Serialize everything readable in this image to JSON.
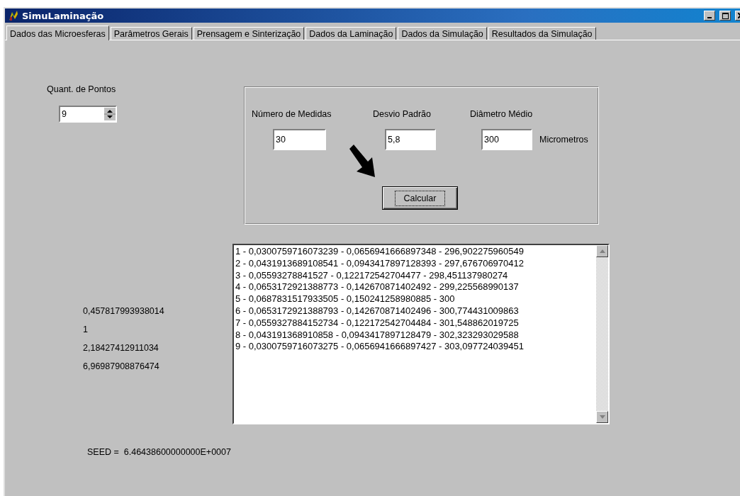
{
  "window": {
    "title": "SimuLaminação"
  },
  "tabs": [
    {
      "label": "Dados das Microesferas",
      "selected": true
    },
    {
      "label": "Parâmetros Gerais",
      "selected": false
    },
    {
      "label": "Prensagem e Sinterização",
      "selected": false
    },
    {
      "label": "Dados da Laminação",
      "selected": false
    },
    {
      "label": "Dados da Simulação",
      "selected": false
    },
    {
      "label": "Resultados da Simulação",
      "selected": false
    }
  ],
  "points": {
    "label": "Quant. de Pontos",
    "value": "9"
  },
  "group": {
    "fields": [
      {
        "label": "Número de Medidas",
        "value": "30"
      },
      {
        "label": "Desvio Padrão",
        "value": "5,8"
      },
      {
        "label": "Diâmetro Médio",
        "value": "300",
        "unit": "Micrometros"
      }
    ],
    "button": "Calcular"
  },
  "results": [
    "1 - 0,0300759716073239 - 0,0656941666897348 - 296,902275960549",
    "2 - 0,0431913689108541 - 0,0943417897128393 - 297,676706970412",
    "3 - 0,05593278841527 - 0,122172542704477 - 298,451137980274",
    "4 - 0,0653172921388773 - 0,142670871402492 - 299,225568990137",
    "5 - 0,0687831517933505 - 0,150241258980885 - 300",
    "6 - 0,0653172921388793 - 0,142670871402496 - 300,774431009863",
    "7 - 0,0559327884152734 - 0,122172542704484 - 301,548862019725",
    "8 - 0,043191368910858 - 0,0943417897128479 - 302,323293029588",
    "9 - 0,0300759716073275 - 0,0656941666897427 - 303,097724039451"
  ],
  "values": [
    "0,457817993938014",
    "1",
    "2,18427412911034",
    "6,96987908876474"
  ],
  "seed": "SEED =  6.46438600000000E+0007"
}
